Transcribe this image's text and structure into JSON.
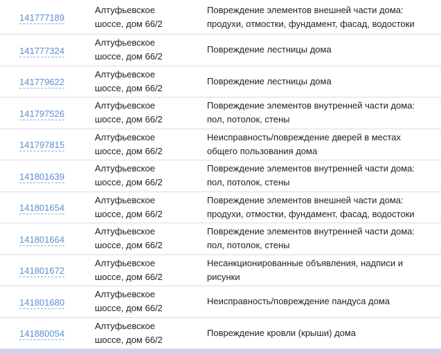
{
  "table": {
    "rows": [
      {
        "id": "141777189",
        "address": "Алтуфьевское\nшоссе, дом 66/2",
        "description": "Повреждение элементов внешней части дома:\nпродухи, отмостки, фундамент, фасад, водостоки"
      },
      {
        "id": "141777324",
        "address": "Алтуфьевское\nшоссе, дом 66/2",
        "description": "Повреждение лестницы дома"
      },
      {
        "id": "141779622",
        "address": "Алтуфьевское\nшоссе, дом 66/2",
        "description": "Повреждение лестницы дома"
      },
      {
        "id": "141797526",
        "address": "Алтуфьевское\nшоссе, дом 66/2",
        "description": "Повреждение элементов внутренней части дома:\nпол, потолок, стены"
      },
      {
        "id": "141797815",
        "address": "Алтуфьевское\nшоссе, дом 66/2",
        "description": "Неисправность/повреждение дверей в местах\nобщего пользования дома"
      },
      {
        "id": "141801639",
        "address": "Алтуфьевское\nшоссе, дом 66/2",
        "description": "Повреждение элементов внутренней части дома:\nпол, потолок, стены"
      },
      {
        "id": "141801654",
        "address": "Алтуфьевское\nшоссе, дом 66/2",
        "description": "Повреждение элементов внешней части дома:\nпродухи, отмостки, фундамент, фасад, водостоки"
      },
      {
        "id": "141801664",
        "address": "Алтуфьевское\nшоссе, дом 66/2",
        "description": "Повреждение элементов внутренней части дома:\nпол, потолок, стены"
      },
      {
        "id": "141801672",
        "address": "Алтуфьевское\nшоссе, дом 66/2",
        "description": "Несанкционированные объявления, надписи и\nрисунки"
      },
      {
        "id": "141801680",
        "address": "Алтуфьевское\nшоссе, дом 66/2",
        "description": "Неисправность/повреждение пандуса дома"
      },
      {
        "id": "141880054",
        "address": "Алтуфьевское\nшоссе, дом 66/2",
        "description": "Повреждение кровли (крыши) дома"
      }
    ]
  },
  "colors": {
    "link": "#5a8fd0",
    "text": "#222222",
    "divider": "#d9d9e6",
    "footer": "#d3d2ee"
  }
}
